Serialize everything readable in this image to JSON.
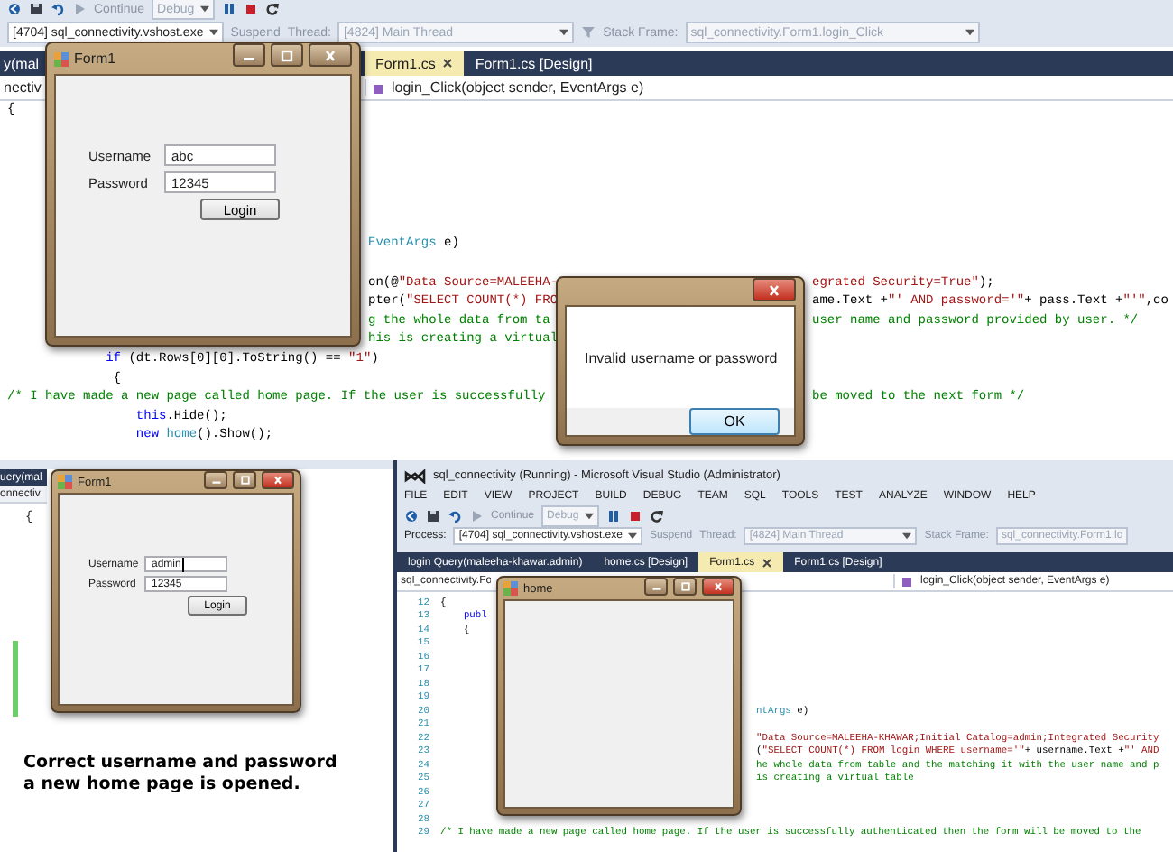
{
  "top_screenshot": {
    "toolbar": {
      "continue_button": "Continue",
      "configuration": "Debug"
    },
    "debug_bar": {
      "process": "[4704] sql_connectivity.vshost.exe",
      "suspend": "Suspend",
      "thread_label": "Thread:",
      "thread": "[4824] Main Thread",
      "stack_frame_label": "Stack Frame:",
      "stack_frame": "sql_connectivity.Form1.login_Click"
    },
    "tabs": [
      {
        "label": "y(mal",
        "selected": false
      },
      {
        "label": "Form1.cs",
        "selected": true
      },
      {
        "label": "Form1.cs [Design]",
        "selected": false
      }
    ],
    "navigation": {
      "type_dropdown": "nectiv",
      "member_dropdown": "login_Click(object sender, EventArgs e)"
    },
    "code_lines": [
      {
        "start": [
          {
            "kind": "plain",
            "text": "{"
          }
        ]
      },
      {
        "middle": [
          {
            "kind": "type",
            "text": "EventArgs"
          },
          {
            "kind": "plain",
            "text": " e)"
          }
        ]
      },
      {
        "middle": [
          {
            "kind": "plain",
            "text": "on(@"
          },
          {
            "kind": "string",
            "text": "\"Data Source=MALEEHA-"
          }
        ],
        "end": [
          {
            "kind": "string",
            "text": "egrated Security=True\""
          },
          {
            "kind": "plain",
            "text": ");"
          }
        ]
      },
      {
        "middle": [
          {
            "kind": "plain",
            "text": "pter("
          },
          {
            "kind": "string",
            "text": "\"SELECT COUNT(*) FRO"
          }
        ],
        "end": [
          {
            "kind": "plain",
            "text": "ame.Text +"
          },
          {
            "kind": "string",
            "text": "\"' AND password='\""
          },
          {
            "kind": "plain",
            "text": "+ pass.Text +"
          },
          {
            "kind": "string",
            "text": "\"'\""
          },
          {
            "kind": "plain",
            "text": ",co"
          }
        ]
      },
      {
        "middle": [
          {
            "kind": "comment",
            "text": "g the whole data from ta"
          }
        ],
        "end": [
          {
            "kind": "comment",
            "text": "user name and password provided by user. */"
          }
        ]
      },
      {
        "middle": [
          {
            "kind": "comment",
            "text": "his is creating a virtual"
          }
        ]
      },
      {
        "start": [
          {
            "kind": "keyword",
            "text": "             if"
          },
          {
            "kind": "plain",
            "text": " (dt.Rows[0][0].ToString() == "
          },
          {
            "kind": "string",
            "text": "\"1\""
          },
          {
            "kind": "plain",
            "text": ")"
          }
        ]
      },
      {
        "start": [
          {
            "kind": "plain",
            "text": "              {"
          }
        ]
      },
      {
        "start": [
          {
            "kind": "comment",
            "text": "/* I have made a new page called home page. If the user is successfully"
          }
        ],
        "end": [
          {
            "kind": "comment",
            "text": "be moved to the next form */"
          }
        ]
      },
      {
        "start": [
          {
            "kind": "keyword",
            "text": "                 this"
          },
          {
            "kind": "plain",
            "text": ".Hide();"
          }
        ]
      },
      {
        "start": [
          {
            "kind": "keyword",
            "text": "                 new"
          },
          {
            "kind": "type",
            "text": " home"
          },
          {
            "kind": "plain",
            "text": "().Show();"
          }
        ]
      }
    ],
    "login_window": {
      "title": "Form1",
      "fields": [
        {
          "label": "Username",
          "value": "abc",
          "focused": false
        },
        {
          "label": "Password",
          "value": "12345",
          "focused": false
        }
      ],
      "button": "Login"
    },
    "message_box": {
      "message": "Invalid username or password",
      "button": "OK"
    }
  },
  "success_screenshot": {
    "side_tabs": [
      "uery(mal",
      "onnectiv"
    ],
    "code_fragment": "{",
    "login_window": {
      "title": "Form1",
      "fields": [
        {
          "label": "Username",
          "value": "admin",
          "focused": true
        },
        {
          "label": "Password",
          "value": "12345",
          "focused": false
        }
      ],
      "button": "Login"
    }
  },
  "caption": "Correct username and password a new home page is opened.",
  "ide_screenshot": {
    "title": "sql_connectivity (Running) - Microsoft Visual Studio (Administrator)",
    "menu": [
      "FILE",
      "EDIT",
      "VIEW",
      "PROJECT",
      "BUILD",
      "DEBUG",
      "TEAM",
      "SQL",
      "TOOLS",
      "TEST",
      "ANALYZE",
      "WINDOW",
      "HELP"
    ],
    "toolbar": {
      "continue_button": "Continue",
      "configuration": "Debug"
    },
    "debug_bar": {
      "process_label": "Process:",
      "process": "[4704] sql_connectivity.vshost.exe",
      "suspend": "Suspend",
      "thread_label": "Thread:",
      "thread": "[4824] Main Thread",
      "stack_frame_label": "Stack Frame:",
      "stack_frame": "sql_connectivity.Form1.lo"
    },
    "tabs": [
      {
        "label": "login Query(maleeha-khawar.admin)",
        "selected": false
      },
      {
        "label": "home.cs [Design]",
        "selected": false
      },
      {
        "label": "Form1.cs",
        "selected": true
      },
      {
        "label": "Form1.cs [Design]",
        "selected": false
      }
    ],
    "navigation": {
      "type_dropdown": "sql_connectivity.Fo",
      "member_dropdown": "login_Click(object sender, EventArgs e)"
    },
    "code_lines": [
      {
        "number": "12",
        "start": [
          {
            "kind": "plain",
            "text": "{"
          }
        ]
      },
      {
        "number": "13",
        "start": [
          {
            "kind": "keyword",
            "text": "    publ"
          }
        ]
      },
      {
        "number": "14",
        "start": [
          {
            "kind": "plain",
            "text": "    {"
          }
        ]
      },
      {
        "number": "15"
      },
      {
        "number": "16"
      },
      {
        "number": "17"
      },
      {
        "number": "18"
      },
      {
        "number": "19"
      },
      {
        "number": "20",
        "end": [
          {
            "kind": "type",
            "text": "ntArgs"
          },
          {
            "kind": "plain",
            "text": " e)"
          }
        ]
      },
      {
        "number": "21"
      },
      {
        "number": "22",
        "end": [
          {
            "kind": "string",
            "text": "\"Data Source=MALEEHA-KHAWAR;Initial Catalog=admin;Integrated Security"
          }
        ]
      },
      {
        "number": "23",
        "end": [
          {
            "kind": "plain",
            "text": "("
          },
          {
            "kind": "string",
            "text": "\"SELECT COUNT(*) FROM login WHERE username='\""
          },
          {
            "kind": "plain",
            "text": "+ username.Text +"
          },
          {
            "kind": "string",
            "text": "\"' AND"
          }
        ]
      },
      {
        "number": "24",
        "end": [
          {
            "kind": "comment",
            "text": "he whole data from table and the matching it with the user name and p"
          }
        ]
      },
      {
        "number": "25",
        "end": [
          {
            "kind": "comment",
            "text": "is creating a virtual table"
          }
        ]
      },
      {
        "number": "26"
      },
      {
        "number": "27"
      },
      {
        "number": "28"
      },
      {
        "number": "29",
        "start": [
          {
            "kind": "comment",
            "text": "/* I have made a new page called home page. If the user is successfully authenticated then the form will be moved to the"
          }
        ]
      }
    ],
    "home_window": {
      "title": "home"
    }
  }
}
